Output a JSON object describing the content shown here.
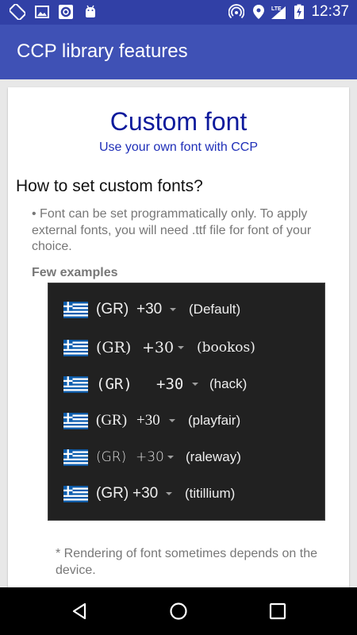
{
  "status_bar": {
    "time": "12:37",
    "icons": [
      "screen-rotation-icon",
      "image-icon",
      "record-icon",
      "android-icon",
      "hotspot-icon",
      "location-icon",
      "signal-lte-icon",
      "battery-charging-icon"
    ]
  },
  "app_bar": {
    "title": "CCP library features"
  },
  "card": {
    "heading": "Custom font",
    "subheading": "Use your own font with CCP",
    "section_title": "How to set custom fonts?",
    "description": "• Font can be set programmatically only. To apply external fonts, you will need .ttf file for font of your choice.",
    "examples_label": "Few examples",
    "examples": [
      {
        "code": "(GR)",
        "phone": "+30",
        "font": "(Default)"
      },
      {
        "code": "(GR)",
        "phone": "+30",
        "font": "(bookos)"
      },
      {
        "code": "(GR)",
        "phone": "+30",
        "font": "(hack)"
      },
      {
        "code": "(GR)",
        "phone": "+30",
        "font": "(playfair)"
      },
      {
        "code": "(GR)",
        "phone": "+30",
        "font": "(raleway)"
      },
      {
        "code": "(GR)",
        "phone": "+30",
        "font": "(titillium)"
      }
    ],
    "note": "* Rendering of font sometimes depends on the device."
  },
  "nav_bar": {
    "buttons": [
      "back-icon",
      "home-icon",
      "recents-icon"
    ]
  },
  "colors": {
    "primary": "#3f51b5",
    "primary_dark": "#3140a6",
    "heading": "#0d1a9c",
    "flag_blue": "#0d5eaf"
  }
}
